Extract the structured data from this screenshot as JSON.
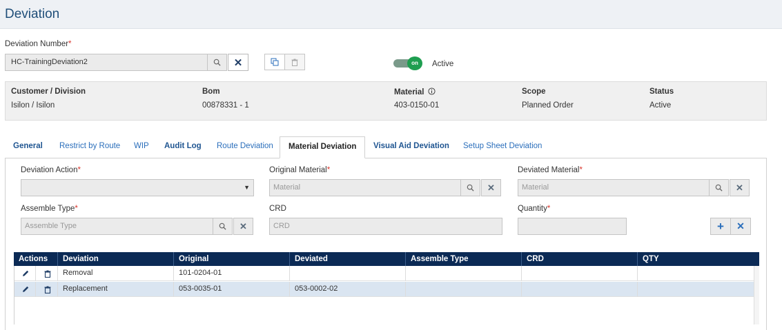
{
  "page": {
    "title": "Deviation"
  },
  "deviation_number": {
    "label": "Deviation Number",
    "required_mark": "*",
    "value": "HC-TrainingDeviation2"
  },
  "status_toggle": {
    "knob_text": "on",
    "label": "Active"
  },
  "info": {
    "headers": [
      "Customer / Division",
      "Bom",
      "Material",
      "Scope",
      "Status"
    ],
    "values": [
      "Isilon / Isilon",
      "00878331 - 1",
      "403-0150-01",
      "Planned Order",
      "Active"
    ],
    "material_info_icon": "info-icon"
  },
  "tabs": [
    {
      "label": "General"
    },
    {
      "label": "Restrict by Route"
    },
    {
      "label": "WIP"
    },
    {
      "label": "Audit Log"
    },
    {
      "label": "Route Deviation"
    },
    {
      "label": "Material Deviation"
    },
    {
      "label": "Visual Aid Deviation"
    },
    {
      "label": "Setup Sheet Deviation"
    }
  ],
  "form": {
    "deviation_action": {
      "label": "Deviation Action",
      "required_mark": "*",
      "value": ""
    },
    "original_material": {
      "label": "Original Material",
      "required_mark": "*",
      "placeholder": "Material"
    },
    "deviated_material": {
      "label": "Deviated Material",
      "required_mark": "*",
      "placeholder": "Material"
    },
    "assemble_type": {
      "label": "Assemble Type",
      "required_mark": "*",
      "placeholder": "Assemble Type"
    },
    "crd": {
      "label": "CRD",
      "placeholder": "CRD"
    },
    "quantity": {
      "label": "Quantity",
      "required_mark": "*",
      "value": ""
    }
  },
  "grid": {
    "columns": [
      "Actions",
      "Deviation",
      "Original",
      "Deviated",
      "Assemble Type",
      "CRD",
      "QTY"
    ],
    "rows": [
      {
        "deviation": "Removal",
        "original": "101-0204-01",
        "deviated": "",
        "assemble_type": "",
        "crd": "",
        "qty": ""
      },
      {
        "deviation": "Replacement",
        "original": "053-0035-01",
        "deviated": "053-0002-02",
        "assemble_type": "",
        "crd": "",
        "qty": ""
      }
    ]
  },
  "colors": {
    "header_bg": "#eef1f5",
    "grid_header": "#0b2a55",
    "toggle_on": "#1e9e50",
    "required": "#d9342b",
    "tab_link": "#2a6ebb"
  }
}
